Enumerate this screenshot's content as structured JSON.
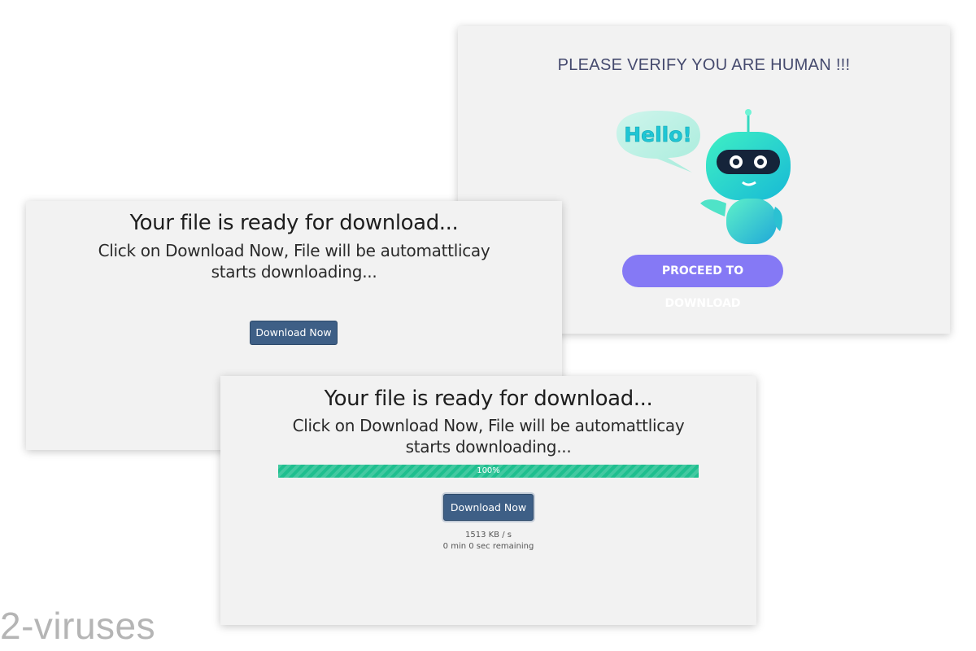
{
  "verify_page": {
    "title": "PLEASE VERIFY YOU ARE HUMAN !!!",
    "bubble_text": "Hello!",
    "proceed_button": "PROCEED TO DOWNLOAD",
    "button_color": "#8579f5",
    "icon": "robot-mascot-icon"
  },
  "ready_page": {
    "title": "Your file is ready for download...",
    "subtitle": "Click on Download Now, File will be automattlicay starts downloading...",
    "download_button": "Download Now",
    "button_color": "#3e5f86"
  },
  "progress_page": {
    "title": "Your file is ready for download...",
    "subtitle": "Click on Download Now, File will be automattlicay starts downloading...",
    "progress": {
      "percent": 100,
      "label": "100%",
      "color": "#1fbf8f"
    },
    "download_button": "Download Now",
    "speed": "1513 KB / s",
    "remaining": "0 min 0 sec remaining"
  },
  "watermark": "2-viruses"
}
